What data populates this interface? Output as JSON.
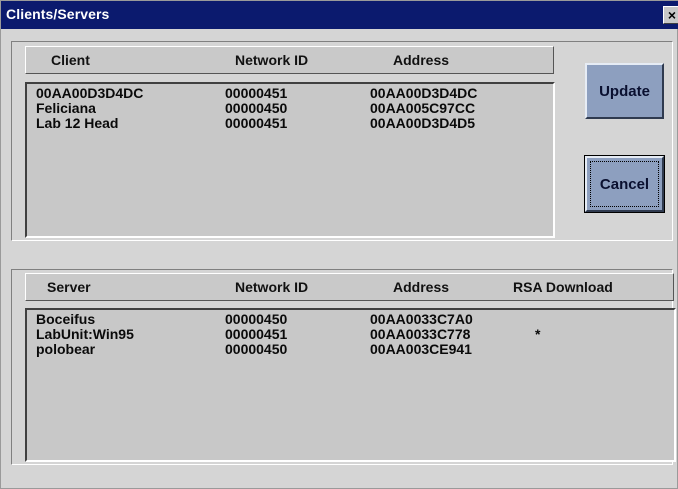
{
  "window": {
    "title": "Clients/Servers",
    "close_label": "×"
  },
  "clients": {
    "headers": {
      "name": "Client",
      "network_id": "Network ID",
      "address": "Address"
    },
    "rows": [
      {
        "name": "00AA00D3D4DC",
        "network_id": "00000451",
        "address": "00AA00D3D4DC"
      },
      {
        "name": "Feliciana",
        "network_id": "00000450",
        "address": "00AA005C97CC"
      },
      {
        "name": "Lab 12 Head",
        "network_id": "00000451",
        "address": "00AA00D3D4D5"
      }
    ]
  },
  "servers": {
    "headers": {
      "name": "Server",
      "network_id": "Network ID",
      "address": "Address",
      "rsa": "RSA Download"
    },
    "rows": [
      {
        "name": "Boceifus",
        "network_id": "00000450",
        "address": "00AA0033C7A0",
        "rsa": ""
      },
      {
        "name": "LabUnit:Win95",
        "network_id": "00000451",
        "address": "00AA0033C778",
        "rsa": "*"
      },
      {
        "name": "polobear",
        "network_id": "00000450",
        "address": "00AA003CE941",
        "rsa": ""
      }
    ]
  },
  "buttons": {
    "update": "Update",
    "cancel": "Cancel"
  },
  "colors": {
    "title_bar": "#0b1a6e",
    "button_face": "#8d9fbf"
  }
}
